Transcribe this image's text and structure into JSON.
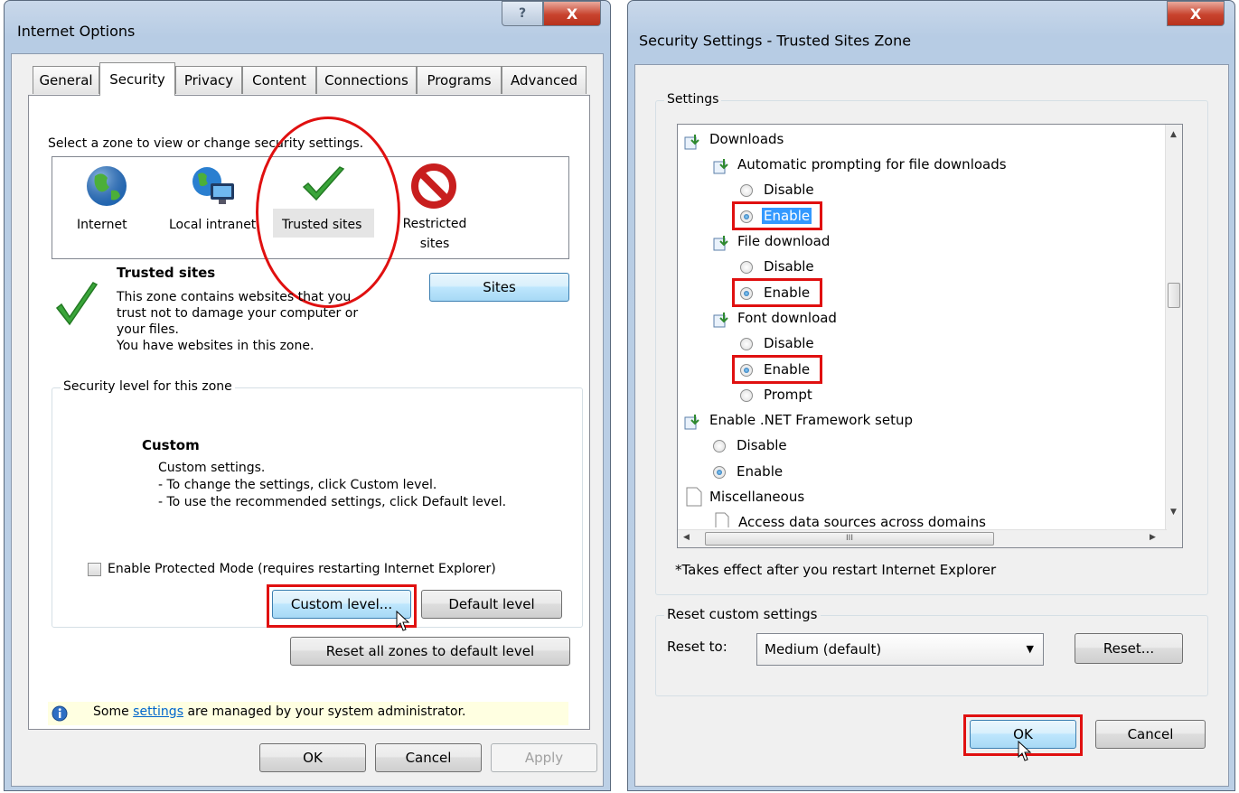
{
  "internet_options": {
    "title": "Internet Options",
    "help_glyph": "?",
    "close_glyph": "X",
    "tabs": [
      "General",
      "Security",
      "Privacy",
      "Content",
      "Connections",
      "Programs",
      "Advanced"
    ],
    "zone_prompt": "Select a zone to view or change security settings.",
    "zones": [
      {
        "label": "Internet",
        "icon": "globe-icon"
      },
      {
        "label": "Local intranet",
        "icon": "intranet-icon"
      },
      {
        "label": "Trusted sites",
        "icon": "checkmark-icon"
      },
      {
        "label": "Restricted\nsites",
        "icon": "restricted-icon"
      }
    ],
    "zone_info": {
      "heading": "Trusted sites",
      "description": "This zone contains websites that you\ntrust not to damage your computer or\nyour files.\nYou have websites in this zone.",
      "sites_button": "Sites"
    },
    "security_level": {
      "legend": "Security level for this zone",
      "level_name": "Custom",
      "level_description": "Custom settings.\n- To change the settings, click Custom level.\n- To use the recommended settings, click Default level.",
      "protected_mode_label": "Enable Protected Mode (requires restarting Internet Explorer)",
      "protected_mode_checked": false,
      "custom_level_button": "Custom level...",
      "default_level_button": "Default level",
      "reset_all_button": "Reset all zones to default level"
    },
    "info_bar": {
      "prefix": "Some ",
      "link": "settings",
      "suffix": " are managed by your system administrator."
    },
    "buttons": {
      "ok": "OK",
      "cancel": "Cancel",
      "apply": "Apply"
    }
  },
  "security_settings": {
    "title": "Security Settings - Trusted Sites Zone",
    "close_glyph": "X",
    "settings_label": "Settings",
    "tree": {
      "downloads": "Downloads",
      "auto_prompt": "Automatic prompting for file downloads",
      "file_download": "File download",
      "font_download": "Font download",
      "net_setup": "Enable .NET Framework setup",
      "misc": "Miscellaneous",
      "access_data": "Access data sources across domains",
      "disable": "Disable",
      "enable": "Enable",
      "prompt": "Prompt"
    },
    "hscroll_grip": "III",
    "note": "*Takes effect after you restart Internet Explorer",
    "reset_group": {
      "legend": "Reset custom settings",
      "reset_to_label": "Reset to:",
      "reset_to_value": "Medium (default)",
      "reset_button": "Reset..."
    },
    "buttons": {
      "ok": "OK",
      "cancel": "Cancel"
    }
  },
  "colors": {
    "highlight_red": "#e01010",
    "selection_blue": "#3399ff",
    "info_yellow": "#ffffe1"
  }
}
